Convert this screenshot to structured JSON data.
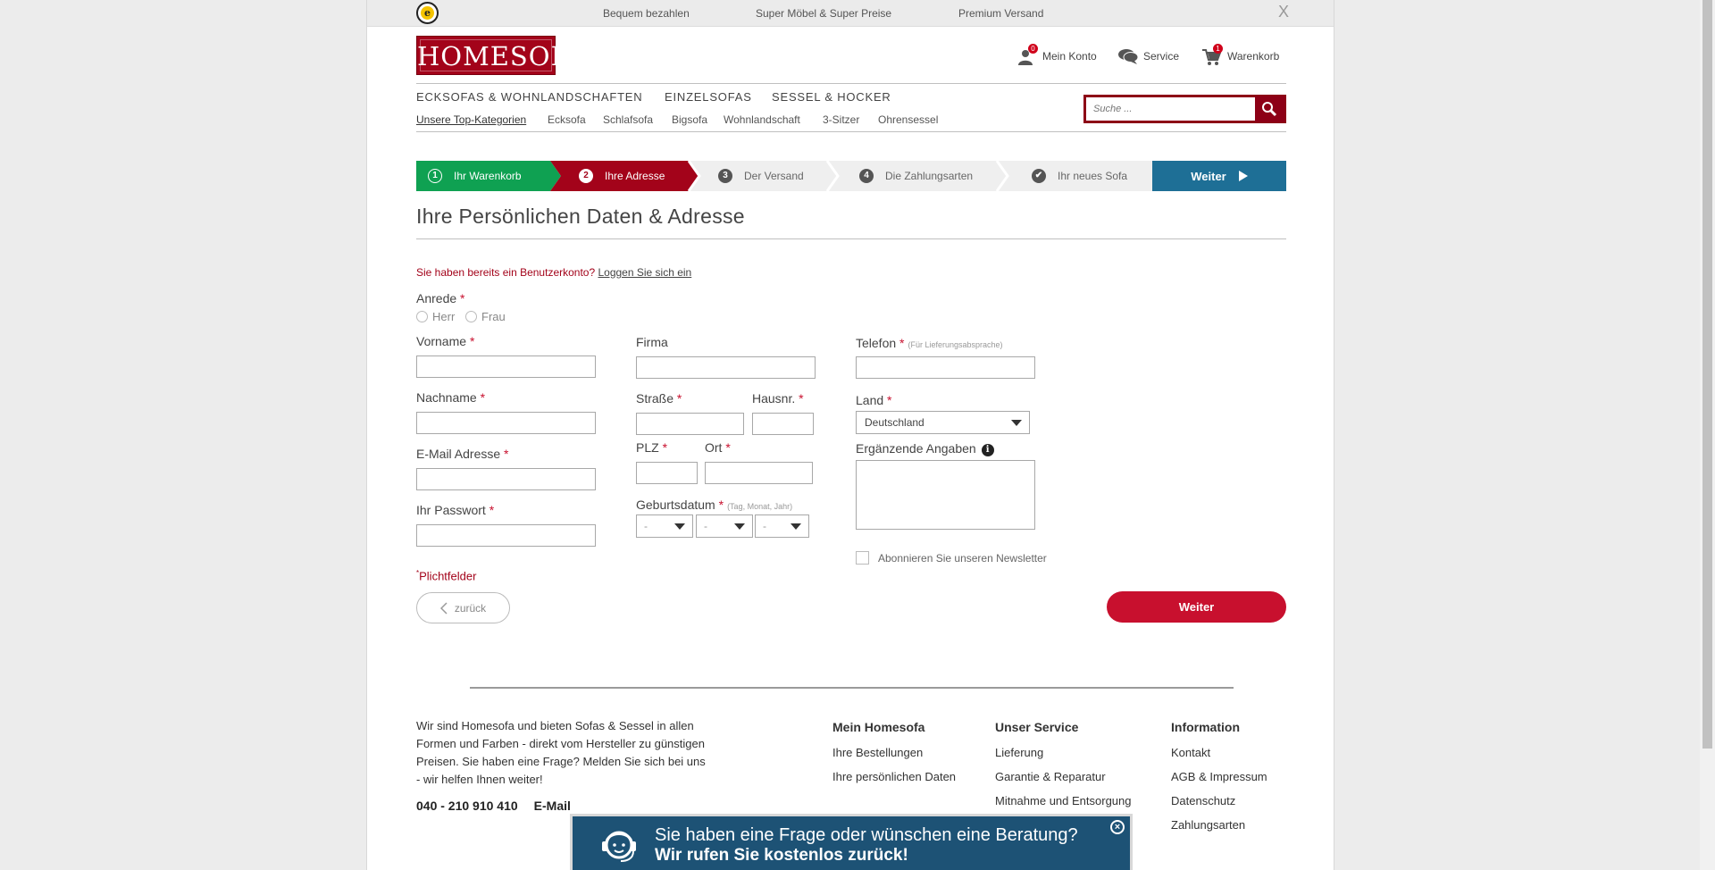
{
  "topbar": {
    "usps": [
      "Bequem bezahlen",
      "Super Möbel & Super Preise",
      "Premium Versand"
    ],
    "close": "X",
    "trusted_letter": "e"
  },
  "header": {
    "logo": "HOMESOFA",
    "account": {
      "label": "Mein Konto",
      "badge": "0"
    },
    "service": {
      "label": "Service"
    },
    "cart": {
      "label": "Warenkorb",
      "badge": "1"
    }
  },
  "nav": {
    "categories": [
      "ECKSOFAS & WOHNLANDSCHAFTEN",
      "EINZELSOFAS",
      "SESSEL & HOCKER"
    ],
    "top_label": "Unsere Top-Kategorien",
    "subcategories": [
      "Ecksofa",
      "Schlafsofa",
      "Bigsofa",
      "Wohnlandschaft",
      "3-Sitzer",
      "Ohrensessel"
    ],
    "search_placeholder": "Suche ..."
  },
  "steps": [
    {
      "num": "1",
      "label": "Ihr Warenkorb",
      "state": "done"
    },
    {
      "num": "2",
      "label": "Ihre Adresse",
      "state": "active"
    },
    {
      "num": "3",
      "label": "Der Versand",
      "state": "todo"
    },
    {
      "num": "4",
      "label": "Die Zahlungsarten",
      "state": "todo"
    },
    {
      "num": "✔",
      "label": "Ihr neues Sofa",
      "state": "todo"
    }
  ],
  "steps_next": "Weiter",
  "form": {
    "title": "Ihre Persönlichen Daten & Adresse",
    "login_note": "Sie haben bereits ein Benutzerkonto?",
    "login_link": "Loggen Sie sich ein",
    "anrede": "Anrede",
    "herr": "Herr",
    "frau": "Frau",
    "vorname": "Vorname",
    "nachname": "Nachname",
    "email": "E-Mail Adresse",
    "passwort": "Ihr Passwort",
    "firma": "Firma",
    "strasse": "Straße",
    "hausnr": "Hausnr.",
    "plz": "PLZ",
    "ort": "Ort",
    "geburtsdatum": "Geburtsdatum",
    "geburtsdatum_hint": "(Tag, Monat, Jahr)",
    "date_day": "-",
    "date_month": "-",
    "date_year": "-",
    "telefon": "Telefon",
    "telefon_hint": "(Für Lieferungsabsprache)",
    "land": "Land",
    "land_value": "Deutschland",
    "ergaenzende": "Ergänzende Angaben",
    "info_glyph": "i",
    "newsletter": "Abonnieren Sie unseren Newsletter",
    "required_star": "*",
    "pflichtfelder": "Plichtfelder",
    "back": "zurück",
    "next": "Weiter"
  },
  "footer": {
    "about": "Wir sind Homesofa und bieten Sofas & Sessel in allen Formen und Farben - direkt vom Hersteller zu günstigen Preisen. Sie haben eine Frage? Melden Sie sich bei uns - wir helfen Ihnen weiter!",
    "phone": "040 - 210 910 410",
    "email": "E-Mail",
    "columns": [
      {
        "title": "Mein Homesofa",
        "links": [
          "Ihre Bestellungen",
          "Ihre persönlichen Daten"
        ]
      },
      {
        "title": "Unser Service",
        "links": [
          "Lieferung",
          "Garantie & Reparatur",
          "Mitnahme und Entsorgung"
        ]
      },
      {
        "title": "Information",
        "links": [
          "Kontakt",
          "AGB & Impressum",
          "Datenschutz",
          "Zahlungsarten"
        ]
      }
    ]
  },
  "callback": {
    "line1": "Sie haben eine Frage oder wünschen eine Beratung?",
    "line2": "Wir rufen Sie kostenlos zurück!",
    "close": "×"
  },
  "colors": {
    "brand_red": "#a3031a",
    "step_green": "#0fa152",
    "step_blue": "#1e6f96",
    "button_red": "#c8102e",
    "callback_blue": "#1d5275"
  }
}
